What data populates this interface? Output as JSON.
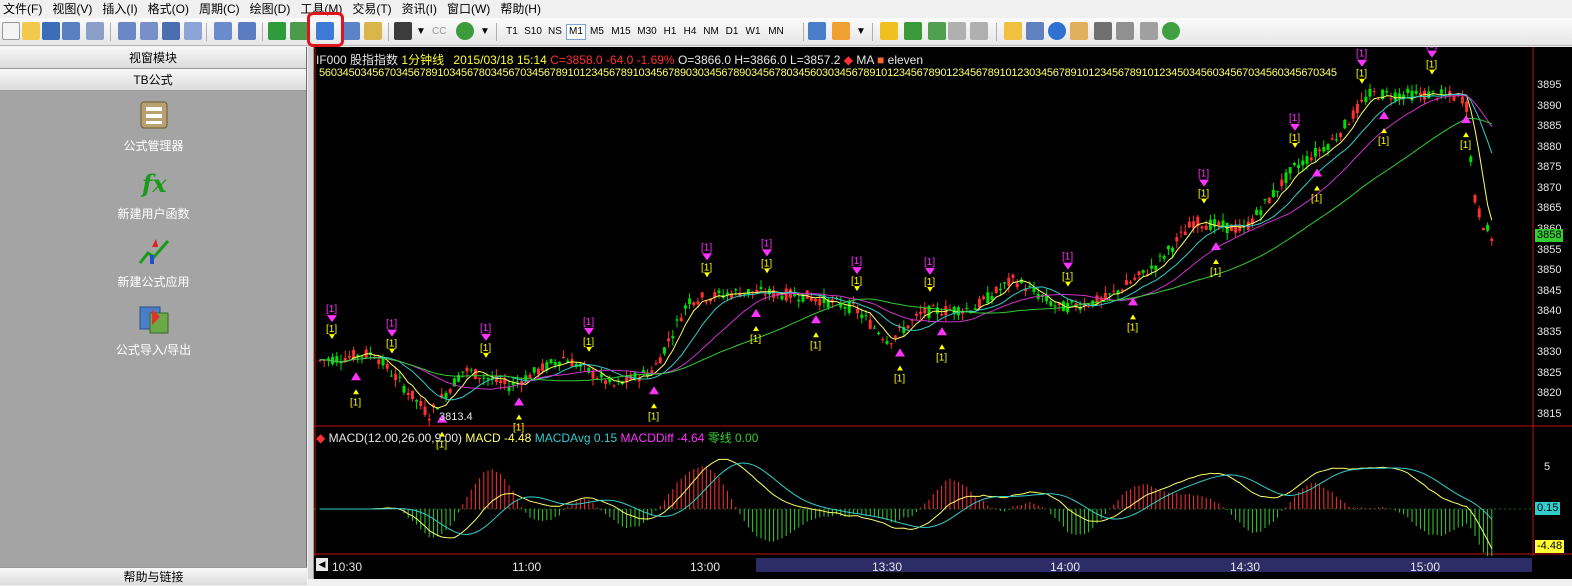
{
  "menu": [
    "文件(F)",
    "视图(V)",
    "插入(I)",
    "格式(O)",
    "周期(C)",
    "绘图(D)",
    "工具(M)",
    "交易(T)",
    "资讯(I)",
    "窗口(W)",
    "帮助(H)"
  ],
  "toolbar": {
    "periods": [
      "T1",
      "S10",
      "NS",
      "M1",
      "M5",
      "M15",
      "M30",
      "H1",
      "H4",
      "NM",
      "D1",
      "W1",
      "MN"
    ],
    "selected_period": "M1",
    "cc_label": "CC"
  },
  "sidebar": {
    "tab_view": "视窗模块",
    "tab_formula": "TB公式",
    "items": [
      {
        "label": "公式管理器",
        "icon": "formula-manager-icon"
      },
      {
        "label": "新建用户函数",
        "icon": "fx-icon"
      },
      {
        "label": "新建公式应用",
        "icon": "new-formula-app-icon"
      },
      {
        "label": "公式导入/导出",
        "icon": "import-export-icon"
      }
    ],
    "footer": "帮助与链接"
  },
  "chart": {
    "symbol": "IF000",
    "name": "股指指数",
    "period": "1分钟线",
    "datetime": "2015/03/18 15:14",
    "close_text": "C=3858.0 -64.0 -1.69%",
    "ohlc_text": "O=3866.0 H=3866.0 L=3857.2",
    "indicator_ma": "MA",
    "indicator_eleven": "eleven",
    "counter_text": "5603450345670345678910345678034567034567891012345678910345678903034567890345678034560303456789101234567890123456789101230345678910123456789101234503456034567034560345670345",
    "low_label": "3813.4",
    "current_price_label": "3858",
    "signal_label": "[1]",
    "price_ticks": [
      "3895",
      "3890",
      "3885",
      "3880",
      "3875",
      "3870",
      "3865",
      "3860",
      "3855",
      "3850",
      "3845",
      "3840",
      "3835",
      "3830",
      "3825",
      "3820",
      "3815"
    ],
    "time_labels": [
      "10:30",
      "11:00",
      "13:00",
      "13:30",
      "14:00",
      "14:30",
      "15:00"
    ],
    "colors": {
      "up": "#ff3030",
      "down": "#00e000",
      "ma_yellow": "#ffff66",
      "ma_cyan": "#33cccc",
      "ma_magenta": "#cc33cc",
      "ma_green": "#33cc33",
      "signal": "#ffff00",
      "signal_magenta": "#ff33ff"
    }
  },
  "macd": {
    "title": "MACD(12.00,26.00,9.00)",
    "macd_label": "MACD -4.48",
    "macd_avg_label": "MACDAvg 0.15",
    "macd_diff_label": "MACDDiff -4.64",
    "zero_label": "零线 0.00",
    "y_tick": "5",
    "avg_badge": "0.15",
    "macd_badge": "-4.48"
  },
  "chart_data": {
    "type": "candlestick",
    "price_range": [
      3813,
      3897
    ],
    "x_labels": [
      "10:30",
      "11:00",
      "13:00",
      "13:30",
      "14:00",
      "14:30",
      "15:00"
    ],
    "key_points": [
      {
        "time": "10:30",
        "price": 3828
      },
      {
        "time": "10:50",
        "price": 3813.4
      },
      {
        "time": "11:00",
        "price": 3828
      },
      {
        "time": "13:00",
        "price": 3822
      },
      {
        "time": "13:10",
        "price": 3843
      },
      {
        "time": "13:30",
        "price": 3844
      },
      {
        "time": "13:45",
        "price": 3833
      },
      {
        "time": "14:00",
        "price": 3843
      },
      {
        "time": "14:15",
        "price": 3842
      },
      {
        "time": "14:25",
        "price": 3860
      },
      {
        "time": "14:35",
        "price": 3875
      },
      {
        "time": "14:45",
        "price": 3890
      },
      {
        "time": "15:00",
        "price": 3893
      },
      {
        "time": "15:10",
        "price": 3860
      },
      {
        "time": "15:14",
        "price": 3858
      }
    ]
  }
}
